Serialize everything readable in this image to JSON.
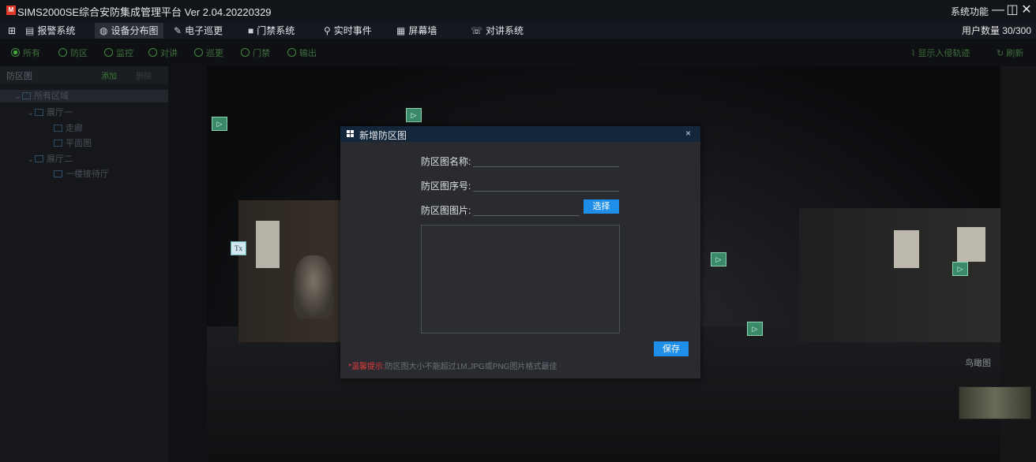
{
  "app": {
    "logo_text": "M",
    "title": "SIMS2000SE综合安防集成管理平台  Ver 2.04.20220329",
    "system_function": "系统功能",
    "minimize": "—",
    "restore": "◫",
    "close": "✕"
  },
  "menu": {
    "grid_icon": "⊞",
    "items": [
      {
        "icon": "▤",
        "label": "报警系统"
      },
      {
        "icon": "◍",
        "label": "设备分布图"
      },
      {
        "icon": "✎",
        "label": "电子巡更"
      },
      {
        "icon": "■",
        "label": "门禁系统"
      },
      {
        "icon": "⚲",
        "label": "实时事件"
      },
      {
        "icon": "▦",
        "label": "屏幕墙"
      },
      {
        "icon": "☏",
        "label": "对讲系统"
      }
    ],
    "user_count": "用户数量 30/300"
  },
  "filters": {
    "options": [
      "所有",
      "防区",
      "监控",
      "对讲",
      "巡更",
      "门禁",
      "输出"
    ],
    "selected": "所有",
    "show_track": "显示入侵轨迹",
    "refresh": "刷新"
  },
  "tree": {
    "title": "防区图",
    "add": "添加",
    "delete": "删除",
    "nodes": [
      {
        "label": "所有区域",
        "level": 0
      },
      {
        "label": "展厅一",
        "level": 1
      },
      {
        "label": "走廊",
        "level": 2
      },
      {
        "label": "平面图",
        "level": 2
      },
      {
        "label": "展厅二",
        "level": 1
      },
      {
        "label": "一楼接待厅",
        "level": 2
      }
    ]
  },
  "scene": {
    "minimap_label": "鸟瞰图",
    "tx_label": "Tx"
  },
  "dialog": {
    "title": "新增防区图",
    "close": "×",
    "name_label": "防区图名称:",
    "name_value": "",
    "order_label": "防区图序号:",
    "order_value": "",
    "image_label": "防区图图片:",
    "image_value": "",
    "choose_button": "选择",
    "save_button": "保存",
    "hint_prefix": "*温馨提示:",
    "hint_text": "防区图大小不能超过1M,JPG或PNG图片格式最佳"
  },
  "colors": {
    "accent_blue": "#1e8ee8",
    "dialog_header": "#14263a",
    "hint_red": "#e03c3c",
    "radio_green": "#49a53f"
  }
}
